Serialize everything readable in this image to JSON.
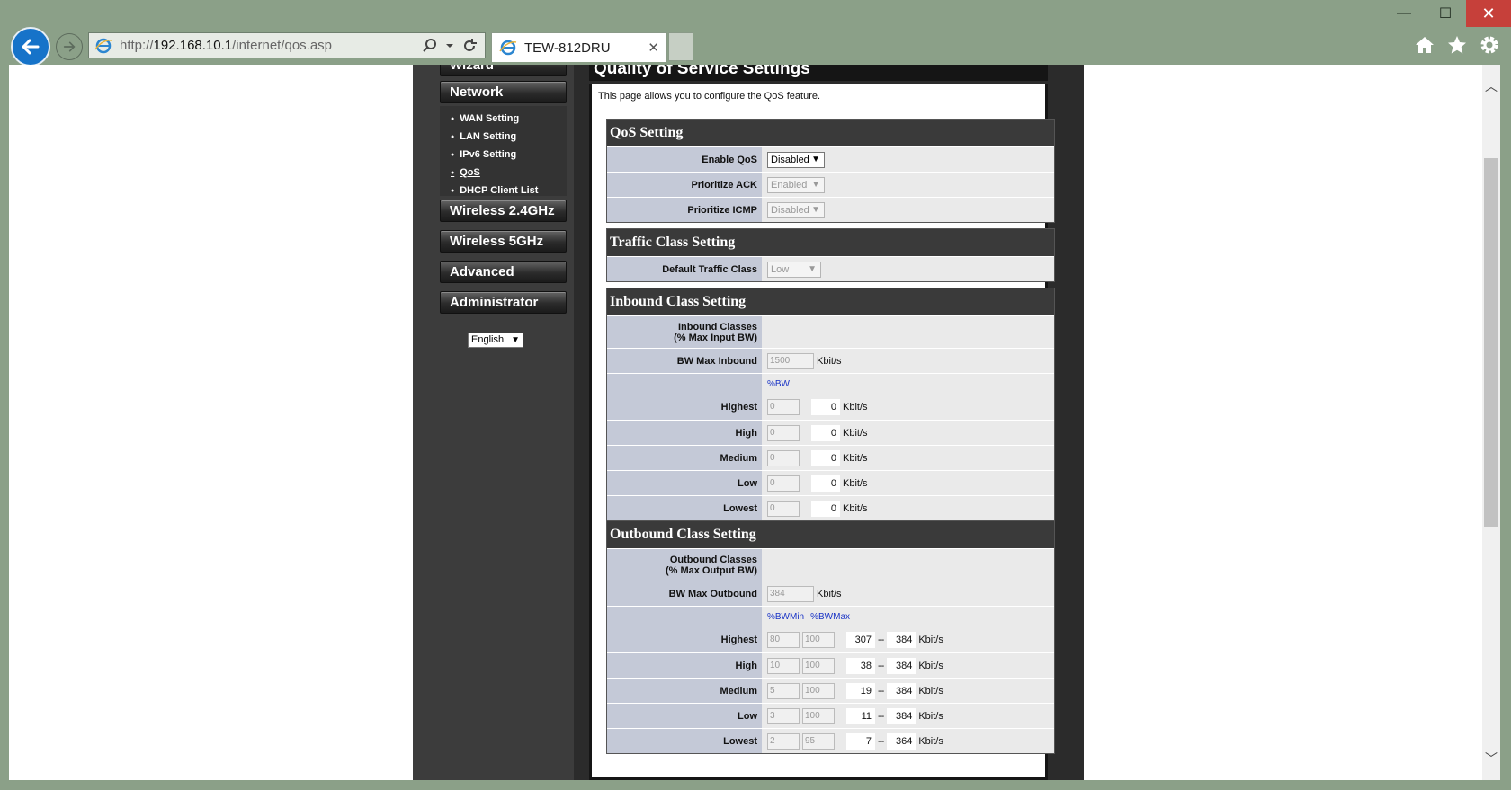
{
  "browser": {
    "url_prefix": "http://",
    "url_host": "192.168.10.1",
    "url_path": "/internet/qos.asp",
    "tab_title": "TEW-812DRU",
    "window_min": "—",
    "window_max": "☐",
    "window_close": "✕"
  },
  "sidebar": {
    "wizard": "Wizard",
    "network": "Network",
    "network_items": [
      "WAN Setting",
      "LAN Setting",
      "IPv6 Setting",
      "QoS",
      "DHCP Client List"
    ],
    "wireless24": "Wireless 2.4GHz",
    "wireless5": "Wireless 5GHz",
    "advanced": "Advanced",
    "administrator": "Administrator",
    "language": "English"
  },
  "content": {
    "title": "Quality of Service Settings",
    "intro": "This page allows you to configure the QoS feature.",
    "qos": {
      "title": "QoS Setting",
      "enable_label": "Enable QoS",
      "enable_value": "Disabled",
      "ack_label": "Prioritize ACK",
      "ack_value": "Enabled",
      "icmp_label": "Prioritize ICMP",
      "icmp_value": "Disabled"
    },
    "traffic": {
      "title": "Traffic Class Setting",
      "default_label": "Default Traffic Class",
      "default_value": "Low"
    },
    "inbound": {
      "title": "Inbound Class Setting",
      "classes_label_1": "Inbound Classes",
      "classes_label_2": "(% Max Input BW)",
      "bwmax_label": "BW Max Inbound",
      "bwmax_value": "1500",
      "unit": "Kbit/s",
      "col_bw": "%BW",
      "rows": [
        {
          "label": "Highest",
          "pct": "0",
          "kbit": "0"
        },
        {
          "label": "High",
          "pct": "0",
          "kbit": "0"
        },
        {
          "label": "Medium",
          "pct": "0",
          "kbit": "0"
        },
        {
          "label": "Low",
          "pct": "0",
          "kbit": "0"
        },
        {
          "label": "Lowest",
          "pct": "0",
          "kbit": "0"
        }
      ]
    },
    "outbound": {
      "title": "Outbound Class Setting",
      "classes_label_1": "Outbound Classes",
      "classes_label_2": "(% Max Output BW)",
      "bwmax_label": "BW Max Outbound",
      "bwmax_value": "384",
      "unit": "Kbit/s",
      "col_min": "%BWMin",
      "col_max": "%BWMax",
      "sep": "--",
      "rows": [
        {
          "label": "Highest",
          "min": "80",
          "max": "100",
          "kmin": "307",
          "kmax": "384"
        },
        {
          "label": "High",
          "min": "10",
          "max": "100",
          "kmin": "38",
          "kmax": "384"
        },
        {
          "label": "Medium",
          "min": "5",
          "max": "100",
          "kmin": "19",
          "kmax": "384"
        },
        {
          "label": "Low",
          "min": "3",
          "max": "100",
          "kmin": "11",
          "kmax": "384"
        },
        {
          "label": "Lowest",
          "min": "2",
          "max": "95",
          "kmin": "7",
          "kmax": "364"
        }
      ]
    }
  }
}
